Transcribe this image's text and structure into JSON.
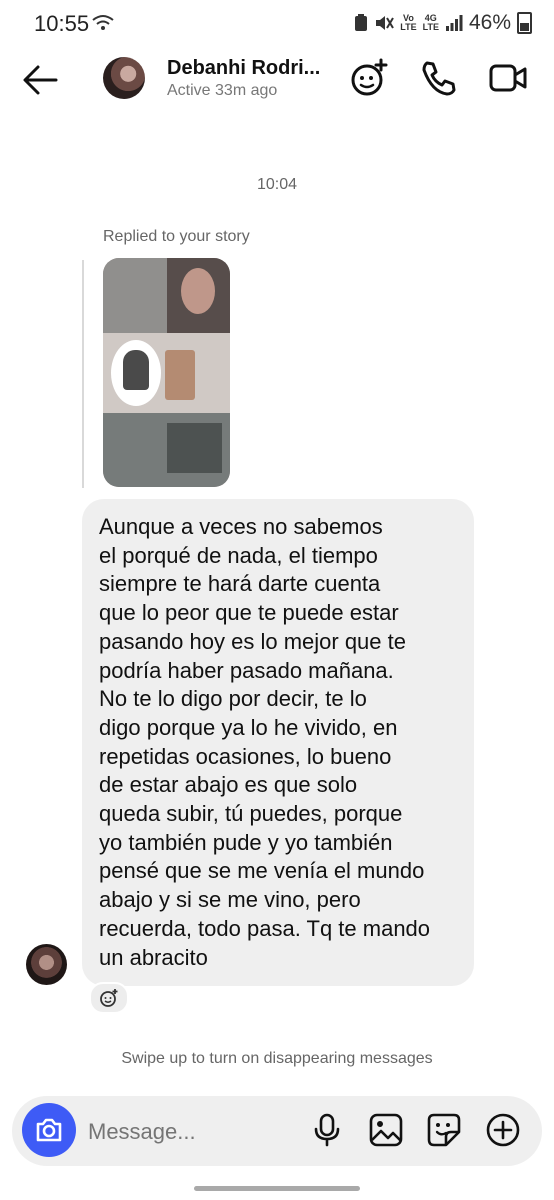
{
  "status_bar": {
    "time": "10:55",
    "battery": "46%",
    "net_top": "Vo",
    "net_bottom": "LTE",
    "lte_top": "4G",
    "lte_bottom": "LTE"
  },
  "header": {
    "name": "Debanhi Rodri...",
    "status": "Active 33m ago"
  },
  "chat": {
    "timestamp": "10:04",
    "reply_label": "Replied to your story",
    "message": "Aunque a veces no sabemos\nel porqué de nada, el tiempo\nsiempre te hará darte cuenta\nque lo peor que te puede estar\npasando hoy es lo mejor que te\npodría haber pasado mañana.\nNo te lo digo por decir, te lo\ndigo porque ya lo he vivido, en\nrepetidas ocasiones, lo bueno\nde estar abajo es que solo\nqueda subir, tú puedes, porque\nyo también pude y yo también\npensé que se me venía el mundo\nabajo y si se me vino, pero\nrecuerda, todo pasa. Tq te mando\nun abracito",
    "disappearing_hint": "Swipe up to turn on disappearing messages"
  },
  "composer": {
    "placeholder": "Message..."
  },
  "icons": {
    "back": "arrow-left-icon",
    "effects": "face-sparkle-icon",
    "call": "phone-icon",
    "video": "video-camera-icon",
    "camera": "camera-icon",
    "mic": "microphone-icon",
    "gallery": "image-icon",
    "sticker": "sticker-icon",
    "add": "plus-circle-icon",
    "reaction": "add-reaction-icon"
  },
  "colors": {
    "accent": "#3e5bf6",
    "bubble": "#efefef"
  }
}
